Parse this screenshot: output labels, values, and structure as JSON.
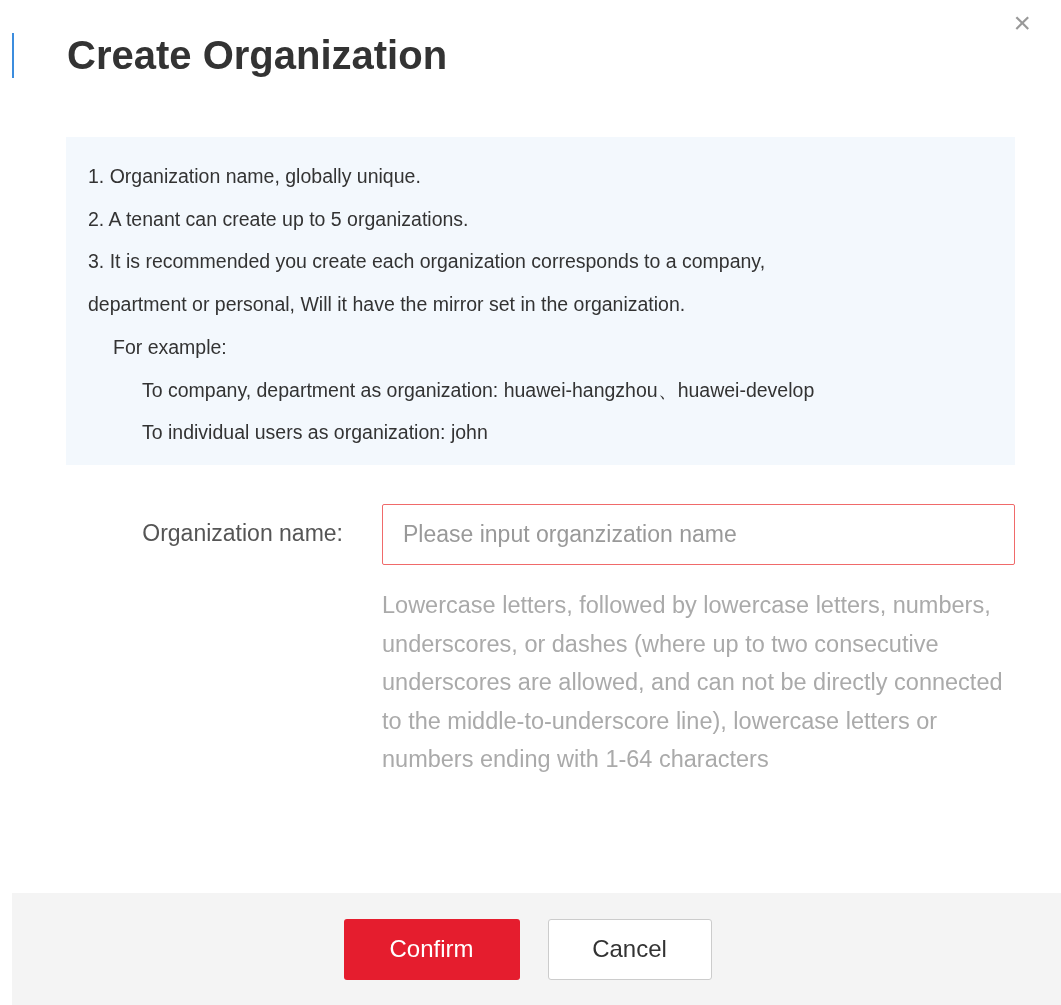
{
  "dialog": {
    "title": "Create Organization",
    "close": "×"
  },
  "notes": [
    {
      "kind": "item",
      "text": "1. Organization name, globally unique."
    },
    {
      "kind": "item",
      "text": "2. A tenant can create up to 5 organizations."
    },
    {
      "kind": "item",
      "text": "3. It is recommended you create each organization corresponds to a company,"
    },
    {
      "kind": "item",
      "text": "department or personal, Will it have the mirror set in the organization."
    },
    {
      "kind": "heading",
      "text": "For example:"
    },
    {
      "kind": "example",
      "text": "To company, department as organization: huawei-hangzhou、huawei-develop"
    },
    {
      "kind": "example",
      "text": "To individual users as organization: john"
    }
  ],
  "field": {
    "label": "Organization name:",
    "placeholder": "Please input organzization name",
    "invalid": true,
    "help": "Lowercase letters, followed by lowercase letters, numbers, underscores, or dashes (where up to two consecutive underscores are allowed, and can not be directly connected to the middle-to-underscore line), lowercase letters or numbers ending with 1-64 characters"
  },
  "buttons": [
    {
      "kind": "primary",
      "label": "Confirm"
    },
    {
      "kind": "default",
      "label": "Cancel"
    }
  ]
}
